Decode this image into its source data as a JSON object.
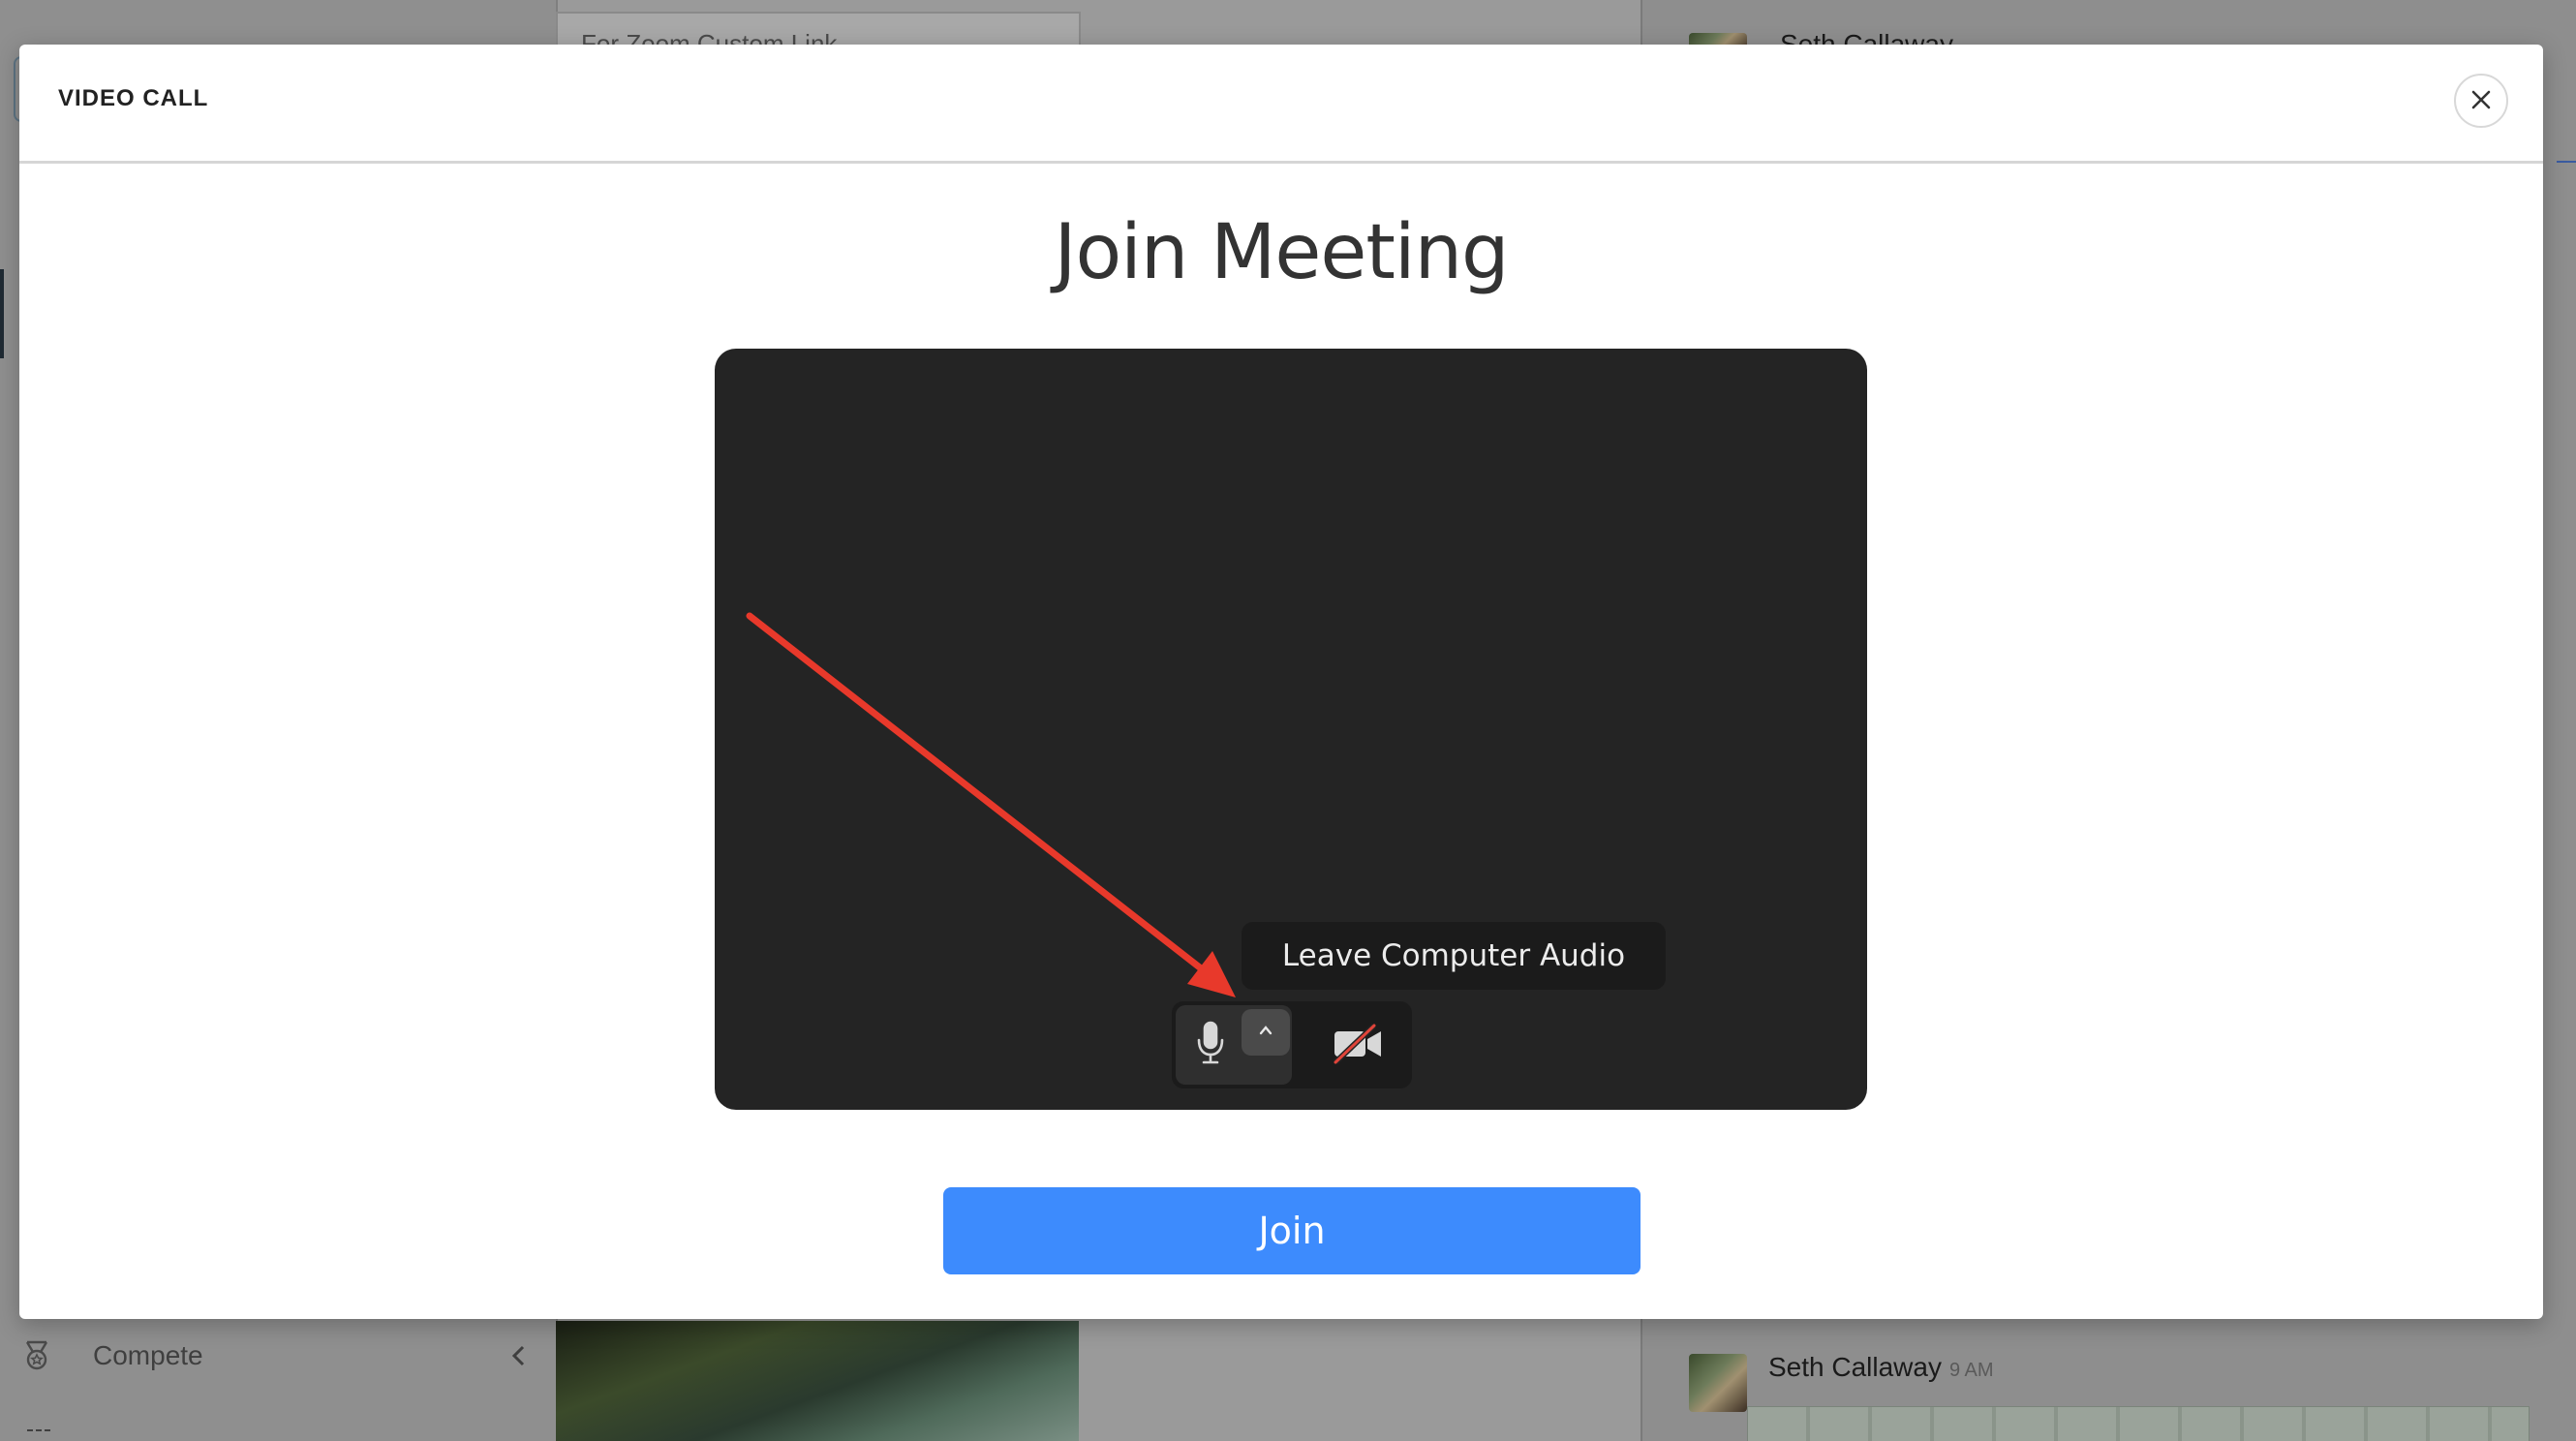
{
  "background": {
    "link_box_text": "For Zoom Custom Link",
    "nav_item_label": "Compete",
    "messages": [
      {
        "author": "Seth Callaway",
        "time": ""
      },
      {
        "author": "Seth Callaway",
        "time": "9 AM"
      }
    ]
  },
  "modal": {
    "title": "VIDEO CALL",
    "heading": "Join Meeting",
    "tooltip": "Leave Computer Audio",
    "join_label": "Join",
    "colors": {
      "join_button": "#3d8bfd",
      "preview_bg": "#242424",
      "annotation_arrow": "#e8392b",
      "video_off_slash": "#e0443a"
    },
    "icons": {
      "close": "close-icon",
      "mic": "microphone-icon",
      "audio_options": "chevron-up-icon",
      "video": "video-off-icon"
    }
  }
}
